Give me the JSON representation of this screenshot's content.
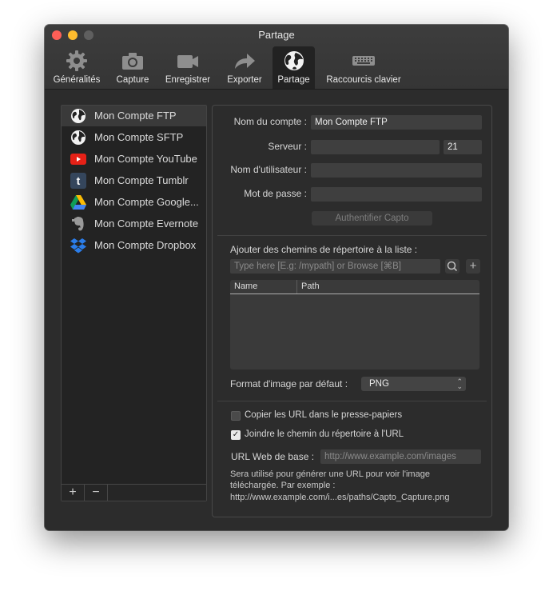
{
  "window": {
    "title": "Partage"
  },
  "toolbar": {
    "items": [
      {
        "label": "Généralités",
        "icon": "gear-icon"
      },
      {
        "label": "Capture",
        "icon": "camera-icon"
      },
      {
        "label": "Enregistrer",
        "icon": "video-camera-icon"
      },
      {
        "label": "Exporter",
        "icon": "share-arrow-icon"
      },
      {
        "label": "Partage",
        "icon": "globe-icon",
        "active": true
      },
      {
        "label": "Raccourcis clavier",
        "icon": "keyboard-icon"
      }
    ]
  },
  "accounts": {
    "items": [
      {
        "label": "Mon Compte FTP",
        "icon": "globe-icon",
        "selected": true
      },
      {
        "label": "Mon Compte SFTP",
        "icon": "globe-icon"
      },
      {
        "label": "Mon Compte YouTube",
        "icon": "youtube-icon"
      },
      {
        "label": "Mon Compte Tumblr",
        "icon": "tumblr-icon"
      },
      {
        "label": "Mon Compte Google...",
        "icon": "google-drive-icon"
      },
      {
        "label": "Mon Compte Evernote",
        "icon": "evernote-icon"
      },
      {
        "label": "Mon Compte Dropbox",
        "icon": "dropbox-icon"
      }
    ],
    "add_label": "+",
    "remove_label": "−"
  },
  "form": {
    "account_name_label": "Nom du compte :",
    "account_name_value": "Mon Compte FTP",
    "server_label": "Serveur :",
    "server_value": "",
    "port_value": "21",
    "username_label": "Nom d'utilisateur :",
    "username_value": "",
    "password_label": "Mot de passe :",
    "password_value": "",
    "auth_button": "Authentifier Capto"
  },
  "paths": {
    "label": "Ajouter des chemins de répertoire à la liste :",
    "placeholder": "Type here [E.g: /mypath] or Browse [⌘B]",
    "add_symbol": "+",
    "columns": [
      "Name",
      "Path"
    ]
  },
  "format": {
    "label": "Format d'image par défaut :",
    "value": "PNG"
  },
  "options": {
    "copy_url_label": "Copier les URL dans le presse-papiers",
    "copy_url_checked": false,
    "join_path_label": "Joindre le chemin du répertoire à l'URL",
    "join_path_checked": true,
    "base_url_label": "URL Web de base :",
    "base_url_placeholder": "http://www.example.com/images",
    "note_line1": "Sera utilisé pour générer une URL pour voir l'image",
    "note_line2": "téléchargée. Par exemple :",
    "note_line3": "http://www.example.com/i...es/paths/Capto_Capture.png"
  },
  "colors": {
    "window_bg": "#2c2c2c",
    "close": "#fe5f57",
    "minimize": "#febc2e",
    "youtube": "#e62117",
    "tumblr": "#35465c",
    "dropbox": "#2b7de9"
  }
}
